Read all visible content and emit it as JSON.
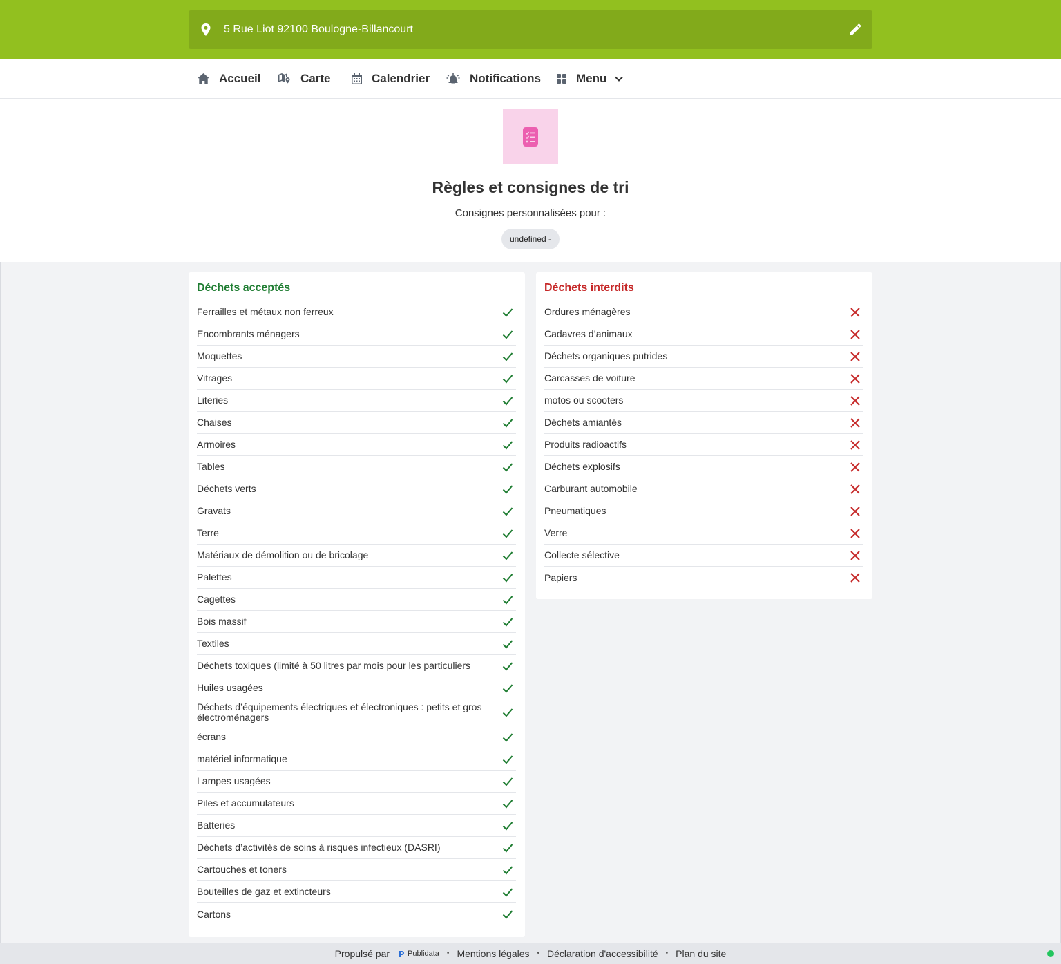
{
  "address": {
    "text": "5 Rue Liot 92100 Boulogne-Billancourt",
    "pin_icon": "map-pin-icon",
    "edit_icon": "pencil-icon"
  },
  "nav": {
    "home": "Accueil",
    "map": "Carte",
    "calendar": "Calendrier",
    "notifications": "Notifications",
    "menu": "Menu"
  },
  "hero": {
    "icon": "checklist-icon",
    "title": "Règles et consignes de tri",
    "subtitle": "Consignes personnalisées pour :",
    "pill": "undefined -"
  },
  "accepted": {
    "title": "Déchets acceptés",
    "items": [
      "Ferrailles et métaux non ferreux",
      "Encombrants ménagers",
      "Moquettes",
      "Vitrages",
      "Literies",
      "Chaises",
      "Armoires",
      "Tables",
      "Déchets verts",
      "Gravats",
      "Terre",
      "Matériaux de démolition ou de bricolage",
      "Palettes",
      "Cagettes",
      "Bois massif",
      "Textiles",
      "Déchets toxiques (limité à 50 litres par mois pour les particuliers",
      "Huiles usagées",
      "Déchets d’équipements électriques et électroniques : petits et gros électroménagers",
      "écrans",
      "matériel informatique",
      "Lampes usagées",
      "Piles et accumulateurs",
      "Batteries",
      "Déchets d’activités de soins à risques infectieux (DASRI)",
      "Cartouches et toners",
      "Bouteilles de gaz et extincteurs",
      "Cartons"
    ]
  },
  "forbidden": {
    "title": "Déchets interdits",
    "items": [
      "Ordures ménagères",
      "Cadavres d’animaux",
      "Déchets organiques putrides",
      "Carcasses de voiture",
      "motos ou scooters",
      "Déchets amiantés",
      "Produits radioactifs",
      "Déchets explosifs",
      "Carburant automobile",
      "Pneumatiques",
      "Verre",
      "Collecte sélective",
      "Papiers"
    ]
  },
  "footer": {
    "powered_by": "Propulsé par",
    "brand": "Publidata",
    "legal": "Mentions légales",
    "accessibility": "Déclaration d'accessibilité",
    "sitemap": "Plan du site"
  },
  "colors": {
    "topbar": "#92c01f",
    "address_box": "#82aa1b",
    "accepted": "#1f7d32",
    "forbidden": "#c62828",
    "hero_icon_bg": "#f9d3ea",
    "hero_icon": "#ec5fb0"
  }
}
